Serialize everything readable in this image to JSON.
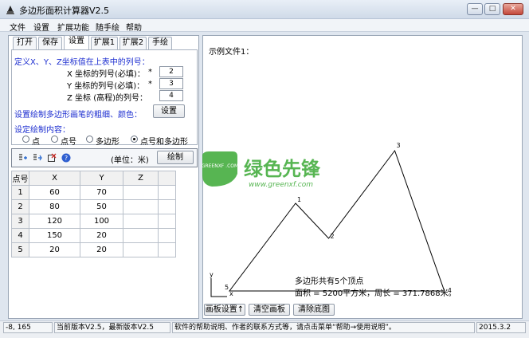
{
  "window": {
    "title": "多边形面积计算器V2.5",
    "minimize_glyph": "—",
    "maximize_glyph": "□",
    "close_glyph": "✕"
  },
  "menu": [
    "文件",
    "设置",
    "扩展功能",
    "随手绘",
    "帮助"
  ],
  "tabs": [
    "打开",
    "保存",
    "设置",
    "扩展1",
    "扩展2",
    "手绘"
  ],
  "active_tab": "设置",
  "settings": {
    "columns_heading": "定义X、Y、Z坐标值在上表中的列号：",
    "x_label": "X 坐标的列号(必填)：",
    "y_label": "Y 坐标的列号(必填)：",
    "z_label": "Z 坐标 (高程)的列号：",
    "required_mark": "*",
    "x_value": "2",
    "y_value": "3",
    "z_value": "4",
    "pen_heading": "设置绘制多边形画笔的粗细、颜色：",
    "pen_button": "设置",
    "draw_heading": "设定绘制内容：",
    "draw_options": [
      "点",
      "点号",
      "多边形",
      "点号和多边形"
    ],
    "draw_selected": "点号和多边形"
  },
  "toolbar": {
    "unit_label": "(单位：米)",
    "draw_button": "绘制",
    "icons": [
      "insert-row-icon",
      "delete-row-icon",
      "clear-table-icon",
      "help-icon"
    ]
  },
  "table": {
    "headers": [
      "点号",
      "X",
      "Y",
      "Z"
    ],
    "rows": [
      {
        "id": "1",
        "x": "60",
        "y": "70",
        "z": ""
      },
      {
        "id": "2",
        "x": "80",
        "y": "50",
        "z": ""
      },
      {
        "id": "3",
        "x": "120",
        "y": "100",
        "z": ""
      },
      {
        "id": "4",
        "x": "150",
        "y": "20",
        "z": ""
      },
      {
        "id": "5",
        "x": "20",
        "y": "20",
        "z": ""
      }
    ]
  },
  "canvas": {
    "caption": "示例文件1：",
    "summary": "多边形共有5个顶点",
    "result": "面积 = 5200平方米，周长 = 371.7868米。",
    "axis_x": "x",
    "axis_y": "y",
    "polygon_color": "#000000",
    "buttons": [
      "画板设置↑",
      "清空画板",
      "清除底图"
    ]
  },
  "watermark": {
    "brand_cn": "绿色先锋",
    "brand_badge": "GREENXF .COM",
    "url": "www.greenxf.com",
    "color": "#3aa935"
  },
  "status": {
    "coords": "-8, 165",
    "version": "当前版本V2.5，最新版本V2.5",
    "help": "软件的帮助说明、作者的联系方式等，请点击菜单“帮助→使用说明”。",
    "date": "2015.3.2"
  }
}
